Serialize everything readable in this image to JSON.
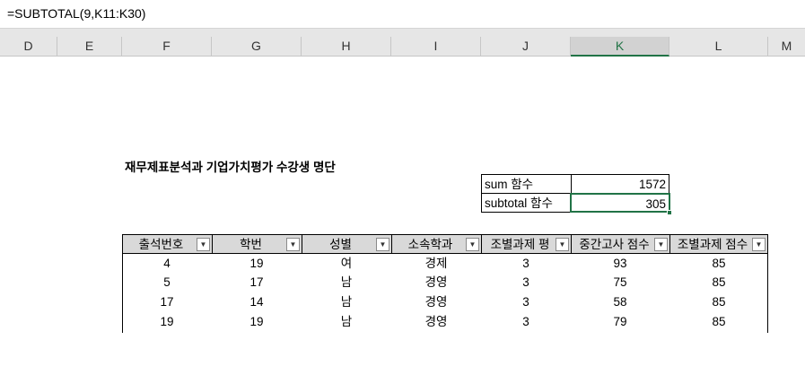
{
  "formula_bar": {
    "formula": "=SUBTOTAL(9,K11:K30)"
  },
  "columns": [
    "D",
    "E",
    "F",
    "G",
    "H",
    "I",
    "J",
    "K",
    "L",
    "M"
  ],
  "selected_column": "K",
  "title": "재무제표분석과 기업가치평가 수강생 명단",
  "summary": {
    "sum_label": "sum 함수",
    "sum_value": "1572",
    "subtotal_label": "subtotal 함수",
    "subtotal_value": "305"
  },
  "table": {
    "headers": [
      "출석번호",
      "학번",
      "성별",
      "소속학과",
      "조별과제 평",
      "중간고사 점수",
      "조별과제 점수"
    ],
    "rows": [
      [
        "4",
        "19",
        "여",
        "경제",
        "3",
        "93",
        "85"
      ],
      [
        "5",
        "17",
        "남",
        "경영",
        "3",
        "75",
        "85"
      ],
      [
        "17",
        "14",
        "남",
        "경영",
        "3",
        "58",
        "85"
      ],
      [
        "19",
        "19",
        "남",
        "경영",
        "3",
        "79",
        "85"
      ]
    ]
  },
  "icons": {
    "filter": "filter-dropdown-icon",
    "filter_active": "filter-applied-icon"
  }
}
